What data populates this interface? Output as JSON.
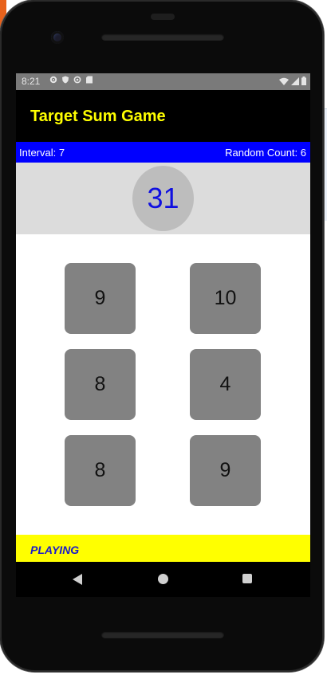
{
  "status_bar": {
    "time": "8:21",
    "left_icons": [
      "settings-icon",
      "shield-icon",
      "sync-icon",
      "sd-card-icon"
    ],
    "right_icons": [
      "wifi-icon",
      "cell-signal-icon",
      "battery-icon"
    ]
  },
  "app_bar": {
    "title": "Target Sum Game"
  },
  "info_bar": {
    "interval": "Interval: 7",
    "random_count": "Random Count: 6"
  },
  "target": {
    "value": "31"
  },
  "numbers": [
    {
      "value": "9"
    },
    {
      "value": "10"
    },
    {
      "value": "8"
    },
    {
      "value": "4"
    },
    {
      "value": "8"
    },
    {
      "value": "9"
    }
  ],
  "game_status": {
    "text": "PLAYING"
  },
  "nav_bar": {
    "buttons": [
      "back-icon",
      "home-icon",
      "recents-icon"
    ]
  },
  "colors": {
    "app_bar_bg": "#000000",
    "title_color": "#ffff00",
    "info_bar_bg": "#0000ff",
    "target_text": "#1010e0",
    "number_button_bg": "#828282",
    "status_strip_bg": "#ffff00",
    "status_text": "#1a1acc"
  }
}
